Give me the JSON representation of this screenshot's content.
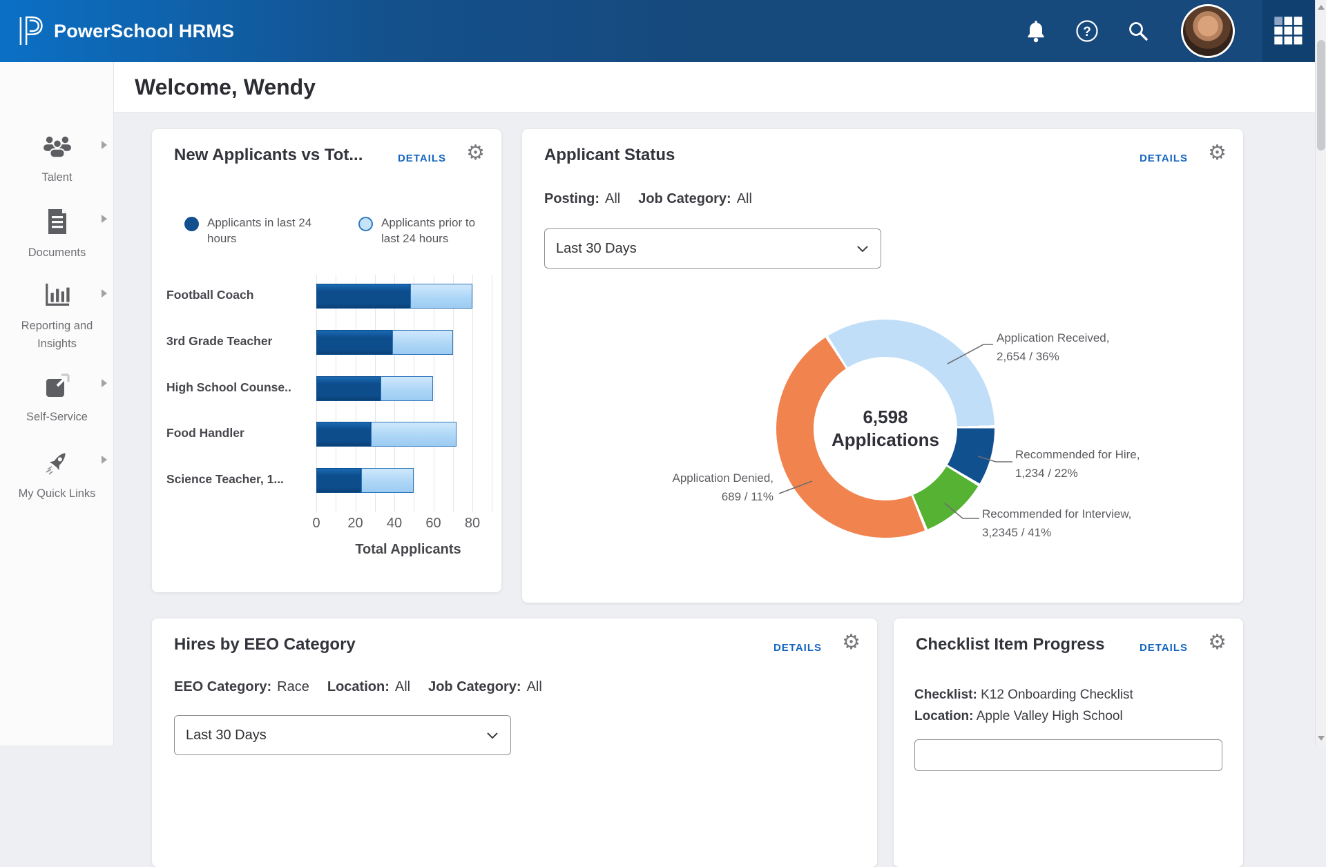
{
  "header": {
    "app_title": "PowerSchool HRMS"
  },
  "sidebar": {
    "items": [
      {
        "label": "Talent",
        "icon": "talent-people-icon"
      },
      {
        "label": "Documents",
        "icon": "document-icon"
      },
      {
        "label": "Reporting and Insights",
        "icon": "bar-chart-icon"
      },
      {
        "label": "Self-Service",
        "icon": "external-link-icon"
      },
      {
        "label": "My Quick Links",
        "icon": "rocket-icon"
      }
    ]
  },
  "welcome": {
    "title": "Welcome, Wendy"
  },
  "cards": {
    "new_applicants": {
      "title": "New Applicants vs Tot...",
      "details": "DETAILS"
    },
    "applicant_status": {
      "title": "Applicant Status",
      "details": "DETAILS",
      "period": "Last 30 Days",
      "filters": [
        {
          "label": "Posting:",
          "value": "All"
        },
        {
          "label": "Job Category:",
          "value": "All"
        }
      ]
    },
    "hires_eeo": {
      "title": "Hires by EEO Category",
      "details": "DETAILS",
      "period": "Last 30 Days",
      "filters": [
        {
          "label": "EEO Category:",
          "value": "Race"
        },
        {
          "label": "Location:",
          "value": "All"
        },
        {
          "label": "Job Category:",
          "value": "All"
        }
      ]
    },
    "checklist": {
      "title": "Checklist Item Progress",
      "details": "DETAILS",
      "filters": [
        {
          "label": "Checklist:",
          "value": "K12 Onboarding Checklist"
        },
        {
          "label": "Location:",
          "value": "Apple Valley High School"
        }
      ]
    }
  },
  "chart_data": [
    {
      "type": "bar",
      "orientation": "horizontal_stacked",
      "title": "New Applicants vs Tot...",
      "categories": [
        "Football Coach",
        "3rd Grade Teacher",
        "High School Counse..",
        "Food Handler",
        "Science Teacher, 1..."
      ],
      "series": [
        {
          "name": "Applicants in last 24 hours",
          "color": "#0d4d8c",
          "values": [
            48,
            39,
            33,
            28,
            23
          ]
        },
        {
          "name": "Applicants prior to last 24 hours",
          "color": "#abd5f6",
          "values": [
            32,
            31,
            27,
            44,
            27
          ]
        }
      ],
      "xlabel": "Total Applicants",
      "xlim": [
        0,
        90
      ],
      "xticks": [
        0,
        20,
        40,
        60,
        80
      ],
      "grid": true
    },
    {
      "type": "pie",
      "donut": true,
      "title": "Applicant Status",
      "center_value": "6,598",
      "center_label": "Applications",
      "start_angle_deg": -32.5,
      "segments": [
        {
          "label": "Application Received",
          "value": "2,654",
          "pct": "36%",
          "color": "#c0def8",
          "sweep_deg": 121.5
        },
        {
          "label": "Recommended for Hire",
          "value": "1,234",
          "pct": "22%",
          "color": "#11508f",
          "sweep_deg": 32
        },
        {
          "label": "Recommended for Interview",
          "value": "3,2345",
          "pct": "41%",
          "color": "#55b233",
          "sweep_deg": 37
        },
        {
          "label": "Application Denied",
          "value": "689",
          "pct": "11%",
          "color": "#f1834e",
          "sweep_deg": 169.5
        }
      ]
    }
  ],
  "colors": {
    "topbar_left": "#0b70c5",
    "topbar_right": "#16497c",
    "details_link": "#1565c0",
    "page_bg": "#edeff2",
    "card_bg": "#ffffff",
    "bar_dark": "#0d4d8c",
    "bar_light": "#abd5f6",
    "donut_lightblue": "#c0def8",
    "donut_navy": "#11508f",
    "donut_green": "#55b233",
    "donut_orange": "#f1834e"
  }
}
